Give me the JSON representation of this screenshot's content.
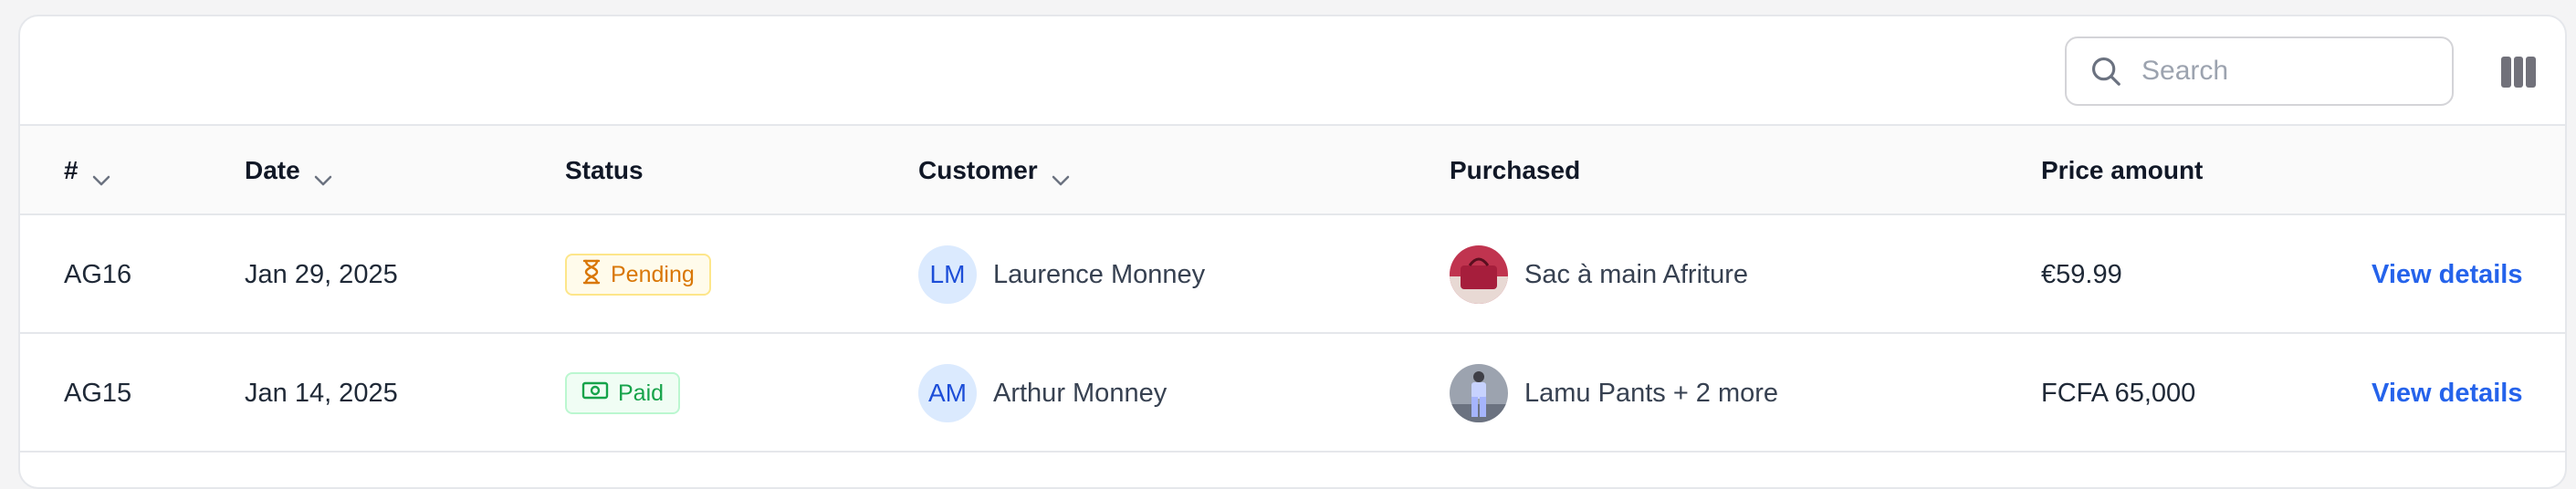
{
  "search": {
    "placeholder": "Search"
  },
  "columns": {
    "number": "#",
    "date": "Date",
    "status": "Status",
    "customer": "Customer",
    "purchased": "Purchased",
    "price": "Price amount"
  },
  "rows": [
    {
      "id": "AG16",
      "date": "Jan 29, 2025",
      "status": "Pending",
      "status_kind": "pending",
      "customer_initials": "LM",
      "customer_name": "Laurence Monney",
      "product": "Sac à main Afriture",
      "price": "€59.99",
      "action": "View details"
    },
    {
      "id": "AG15",
      "date": "Jan 14, 2025",
      "status": "Paid",
      "status_kind": "paid",
      "customer_initials": "AM",
      "customer_name": "Arthur Monney",
      "product": "Lamu Pants + 2 more",
      "price": "FCFA 65,000",
      "action": "View details"
    }
  ],
  "icons": {
    "search": "search-icon",
    "columns": "columns-icon",
    "sort": "chevron-down-icon",
    "pending": "hourglass-icon",
    "paid": "banknote-icon"
  },
  "colors": {
    "link": "#2563eb",
    "pending": "#d97706",
    "paid": "#16a34a",
    "avatar_bg": "#dbeafe",
    "avatar_fg": "#1d4ed8"
  }
}
